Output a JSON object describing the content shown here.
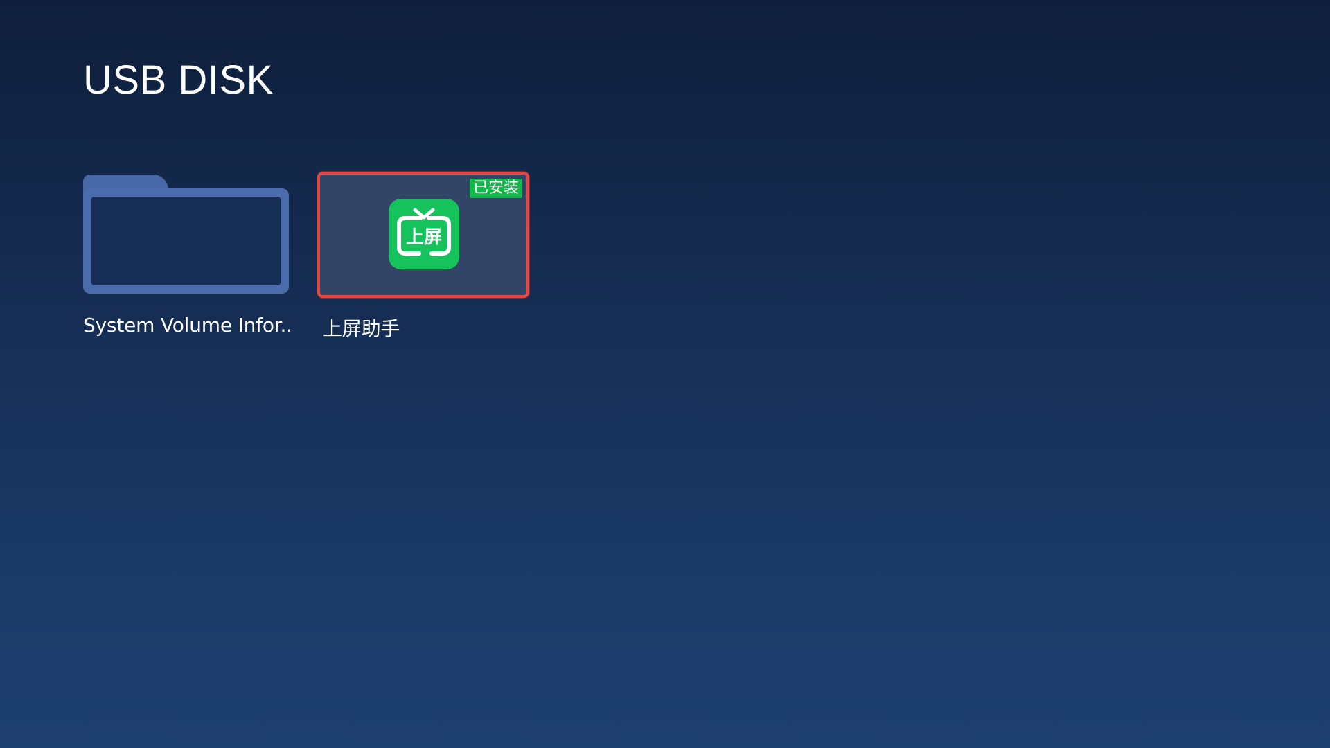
{
  "page": {
    "title": "USB DISK"
  },
  "items": [
    {
      "type": "folder",
      "icon": "folder-icon",
      "label": "System Volume Infor.."
    },
    {
      "type": "app",
      "icon": "tv-app-icon",
      "icon_text": "上屏",
      "label": "上屏助手",
      "badge": "已安装",
      "focused": true
    }
  ],
  "colors": {
    "focus_border": "#e8463e",
    "badge_bg": "#12b84a",
    "app_icon_bg": "#16c25b",
    "folder": "#4a6cad",
    "tile_bg": "#324566"
  }
}
